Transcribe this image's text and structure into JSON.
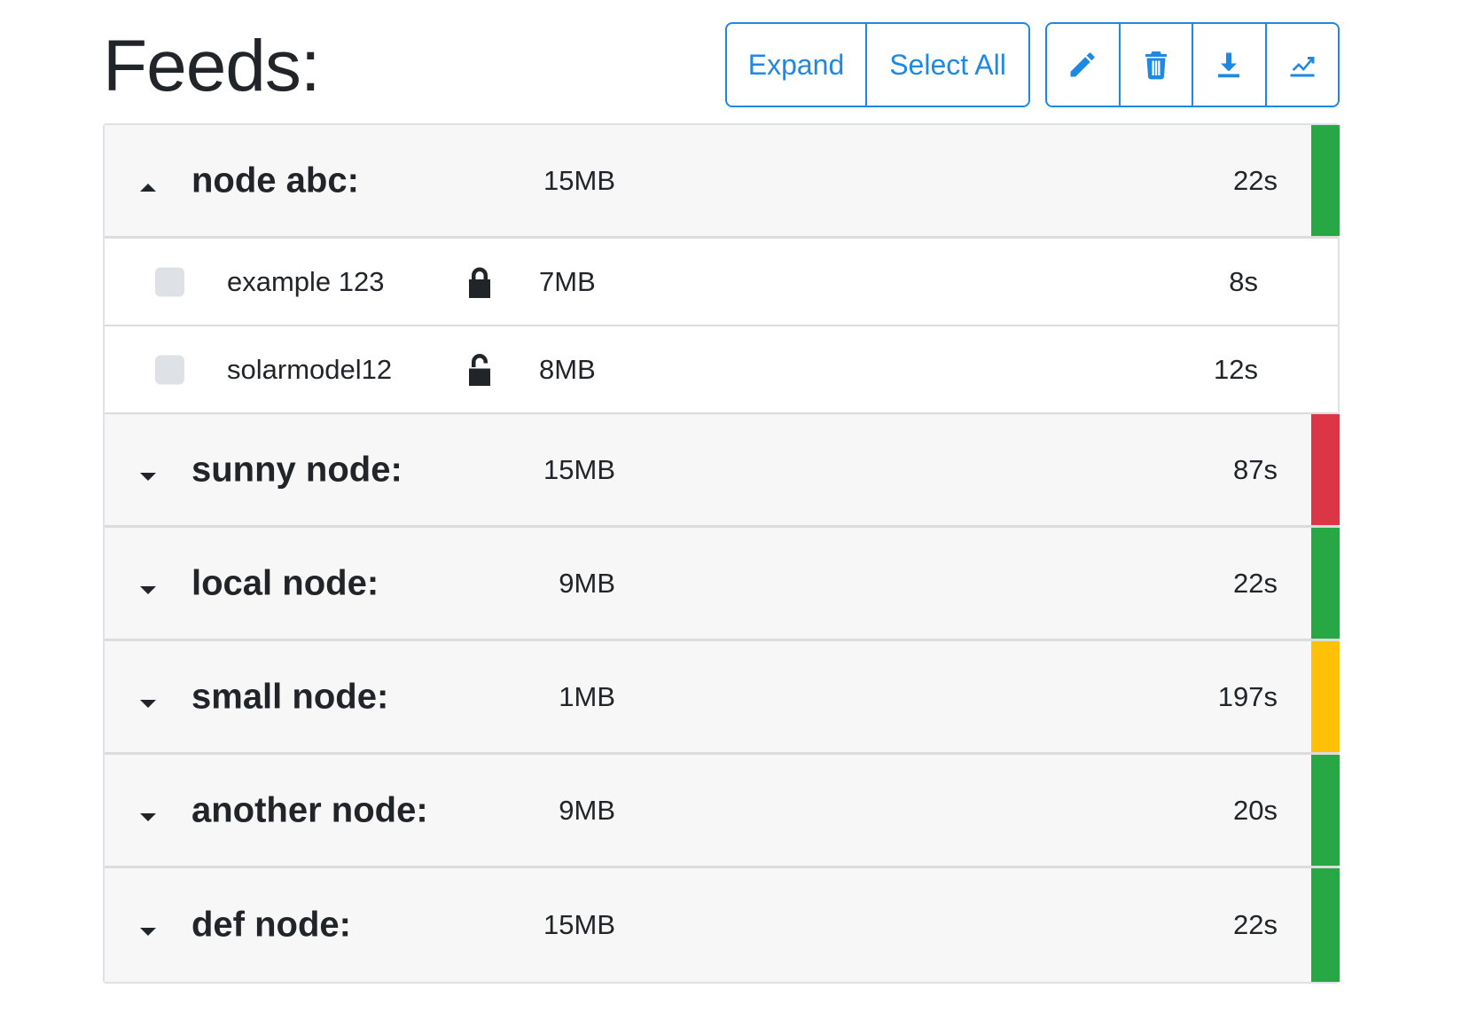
{
  "page": {
    "title": "Feeds:"
  },
  "toolbar": {
    "expand_label": "Expand",
    "select_all_label": "Select All",
    "icons": [
      "pencil-icon",
      "trash-icon",
      "download-icon",
      "chart-line-icon"
    ],
    "accent_color": "#1e88e5"
  },
  "status_colors": {
    "ok": "#28a745",
    "error": "#dc3545",
    "warning": "#ffc107"
  },
  "nodes": [
    {
      "name": "node abc:",
      "size": "15MB",
      "time": "22s",
      "expanded": true,
      "status_color": "#28a745",
      "feeds": [
        {
          "name": "example 123",
          "lock": "locked",
          "size": "7MB",
          "time": "8s"
        },
        {
          "name": "solarmodel12",
          "lock": "unlocked",
          "size": "8MB",
          "time": "12s"
        }
      ]
    },
    {
      "name": "sunny node:",
      "size": "15MB",
      "time": "87s",
      "expanded": false,
      "status_color": "#dc3545"
    },
    {
      "name": "local node:",
      "size": "9MB",
      "time": "22s",
      "expanded": false,
      "status_color": "#28a745"
    },
    {
      "name": "small node:",
      "size": "1MB",
      "time": "197s",
      "expanded": false,
      "status_color": "#ffc107"
    },
    {
      "name": "another node:",
      "size": "9MB",
      "time": "20s",
      "expanded": false,
      "status_color": "#28a745"
    },
    {
      "name": "def node:",
      "size": "15MB",
      "time": "22s",
      "expanded": false,
      "status_color": "#28a745"
    }
  ]
}
